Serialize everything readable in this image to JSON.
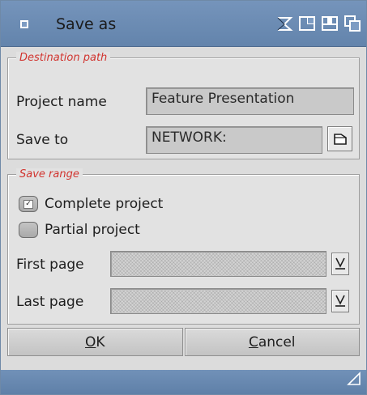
{
  "window": {
    "title": "Save as"
  },
  "destination": {
    "group_title": "Destination path",
    "project_name_label": "Project name",
    "project_name_value": "Feature Presentation",
    "save_to_label": "Save to",
    "save_to_value": "NETWORK:"
  },
  "save_range": {
    "group_title": "Save range",
    "complete_label": "Complete project",
    "complete_checked": true,
    "partial_label": "Partial project",
    "partial_checked": false,
    "first_page_label": "First page",
    "first_page_value": "",
    "last_page_label": "Last page",
    "last_page_value": ""
  },
  "buttons": {
    "ok_underline": "O",
    "ok_rest": "K",
    "cancel_underline": "C",
    "cancel_rest": "ancel"
  },
  "icons": {
    "close": "close-gadget-icon",
    "iconify": "iconify-icon",
    "zoom": "zoom-icon",
    "depth": "depth-icon",
    "file": "file-requester-icon",
    "cycle": "cycle-icon",
    "resize": "resize-icon"
  },
  "colors": {
    "titlebar": "#6c8bb3",
    "group_title": "#d1342f",
    "background": "#dcdcdc"
  }
}
